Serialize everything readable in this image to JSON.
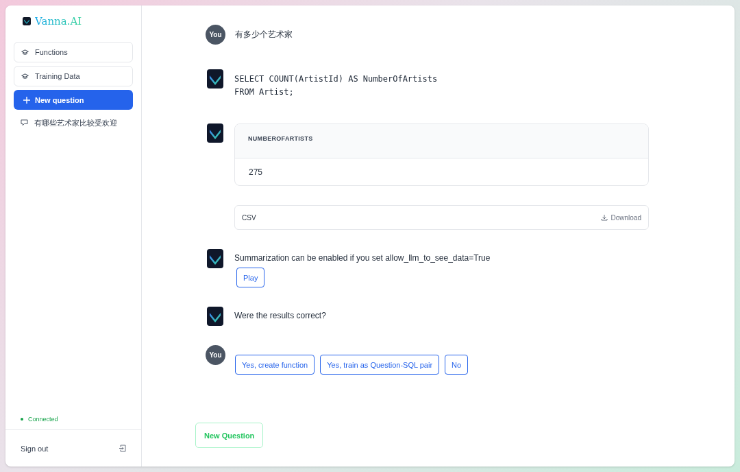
{
  "sidebar": {
    "logo": "Vanna.AI",
    "nav": [
      {
        "label": "Functions"
      },
      {
        "label": "Training Data"
      }
    ],
    "new_question": "New question",
    "history": [
      {
        "label": "有哪些艺术家比较受欢迎"
      }
    ],
    "status": {
      "label": "Connected",
      "connected": true
    },
    "sign_out": "Sign out"
  },
  "messages": [
    {
      "kind": "user",
      "avatar": "You",
      "text": "有多少个艺术家"
    },
    {
      "kind": "sql",
      "lines": [
        "SELECT COUNT(ArtistId) AS NumberOfArtists",
        "FROM Artist;"
      ]
    },
    {
      "kind": "table",
      "columns": [
        "NUMBEROFARTISTS"
      ],
      "rows": [
        [
          "275"
        ]
      ],
      "csv": "CSV",
      "download": "Download"
    },
    {
      "kind": "text",
      "text": "Summarization can be enabled if you set allow_llm_to_see_data=True",
      "buttons": [
        "Play"
      ]
    },
    {
      "kind": "text",
      "text": "Were the results correct?"
    },
    {
      "kind": "user_buttons",
      "avatar": "You",
      "buttons": [
        "Yes, create function",
        "Yes, train as Question-SQL pair",
        "No"
      ]
    }
  ],
  "new_question_button": "New Question"
}
